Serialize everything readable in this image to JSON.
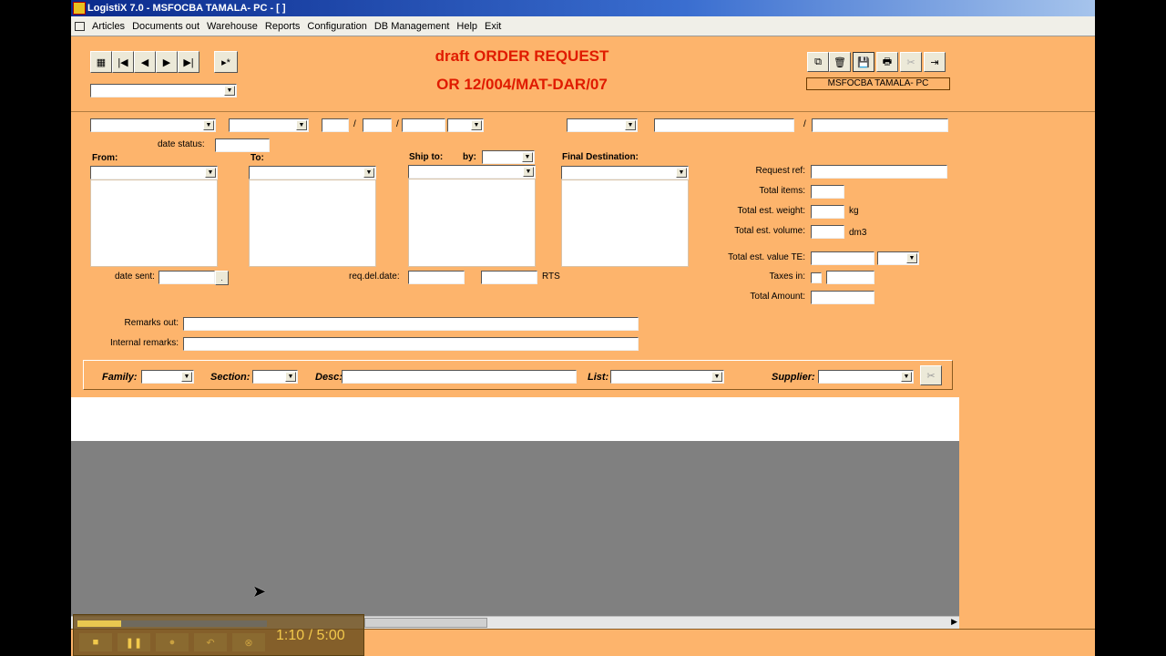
{
  "window": {
    "title": "LogistiX 7.0 - MSFOCBA TAMALA- PC - [ ]"
  },
  "menu": [
    "Articles",
    "Documents out",
    "Warehouse",
    "Reports",
    "Configuration",
    "DB Management",
    "Help",
    "Exit"
  ],
  "nav_buttons": [
    "grid-icon",
    "first-record-icon",
    "previous-record-icon",
    "next-record-icon",
    "last-record-icon",
    "new-record-icon"
  ],
  "header": {
    "title": "draft ORDER REQUEST",
    "number": "OR 12/004/MAT-DAR/07",
    "user_label": "MSFOCBA TAMALA- PC"
  },
  "toolbar_icons": [
    "copy-icon",
    "trash-icon",
    "save-icon",
    "print-icon",
    "cancel-icon",
    "exit-door-icon"
  ],
  "form": {
    "date_status": "date status:",
    "from": "From:",
    "to": "To:",
    "ship_to": "Ship to:",
    "by": "by:",
    "final_destination": "Final Destination:",
    "date_sent": "date sent:",
    "req_del_date": "req.del.date:",
    "rts": "RTS",
    "request_ref": "Request ref:",
    "total_items": "Total items:",
    "total_weight": "Total est. weight:",
    "kg": "kg",
    "total_volume": "Total est. volume:",
    "dm3": "dm3",
    "total_value": "Total est. value TE:",
    "taxes_in": "Taxes in:",
    "total_amount": "Total Amount:",
    "remarks_out": "Remarks out:",
    "internal_remarks": "Internal remarks:",
    "sep1": "/",
    "sep2": "/",
    "sep3": "/"
  },
  "filters": {
    "family": "Family:",
    "section": "Section:",
    "desc": "Desc:",
    "list": "List:",
    "supplier": "Supplier:"
  },
  "player": {
    "time": "1:10 / 5:00",
    "progress": 0.23
  }
}
